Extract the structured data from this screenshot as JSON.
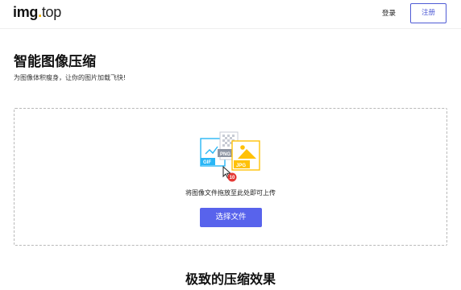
{
  "header": {
    "logo": {
      "main": "img",
      "dot": ".",
      "tld": "top"
    },
    "login_label": "登录",
    "register_label": "注册"
  },
  "hero": {
    "title": "智能图像压缩",
    "subtitle": "为图像体积瘦身，让你的图片加载飞快!"
  },
  "upload": {
    "illustration": {
      "formats": [
        "GIF",
        "PNG",
        "JPG"
      ],
      "file_count_badge": "10"
    },
    "hint": "将图像文件拖放至此处即可上传",
    "button_label": "选择文件"
  },
  "features": {
    "title": "极致的压缩效果"
  },
  "colors": {
    "accent": "#5863ec",
    "logo_dot": "#f5b400",
    "gif": "#29b6f6",
    "png": "#8e95a3",
    "jpg": "#ffc107",
    "badge": "#e53935"
  }
}
